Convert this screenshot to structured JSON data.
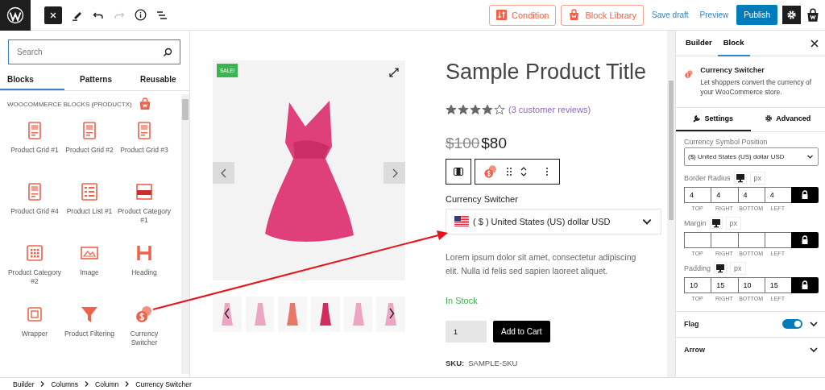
{
  "toolbar": {
    "buttons": [
      {
        "label": "Condition",
        "kind": "condition"
      },
      {
        "label": "Block Library",
        "kind": "library"
      }
    ],
    "links": [
      "Save draft",
      "Preview"
    ],
    "publish": "Publish"
  },
  "inserter": {
    "search": {
      "placeholder": "Search"
    },
    "tabs": [
      {
        "label": "Blocks",
        "selected": true
      },
      {
        "label": "Patterns",
        "selected": false
      },
      {
        "label": "Reusable",
        "selected": false
      }
    ],
    "category": "WOOCOMMERCE BLOCKS (PRODUCTX)",
    "blocks": [
      {
        "label": "Product Grid #1",
        "kind": "grid"
      },
      {
        "label": "Product Grid #2",
        "kind": "grid"
      },
      {
        "label": "Product Grid #3",
        "kind": "grid"
      },
      {
        "label": "Product Grid #4",
        "kind": "grid"
      },
      {
        "label": "Product List #1",
        "kind": "list"
      },
      {
        "label": "Product Category #1",
        "kind": "category"
      },
      {
        "label": "Product Category #2",
        "kind": "tiles"
      },
      {
        "label": "Image",
        "kind": "image"
      },
      {
        "label": "Heading",
        "kind": "heading"
      },
      {
        "label": "Wrapper",
        "kind": "wrapper"
      },
      {
        "label": "Product Filtering",
        "kind": "filter"
      },
      {
        "label": "Currency Switcher",
        "kind": "currency"
      }
    ]
  },
  "product": {
    "badge": "SALE!",
    "title": "Sample Product Title",
    "stars": 4,
    "reviews": "(3 customer reviews)",
    "old_price": "$100",
    "price": "$80",
    "switcher_label": "Currency Switcher",
    "switcher_value": "( $ ) United States (US) dollar USD",
    "description": "Lorem ipsum dolor sit amet, consectetur adipiscing elit. Nulla id felis sed sapien laoreet aliquet.",
    "stock": "In Stock",
    "quantity": "1",
    "add_to_cart": "Add to Cart",
    "sku_label": "SKU:",
    "sku": "SAMPLE-SKU"
  },
  "settings": {
    "tabs": [
      {
        "label": "Builder",
        "selected": false
      },
      {
        "label": "Block",
        "selected": true
      }
    ],
    "block_title": "Currency Switcher",
    "block_description": "Let shoppers convert the currency of your WooCommerce store.",
    "subtabs": [
      {
        "label": "Settings",
        "kind": "wrench",
        "selected": true
      },
      {
        "label": "Advanced",
        "kind": "gear",
        "selected": false
      }
    ],
    "symbol_position": {
      "label": "Currency Symbol Position",
      "value": "($) United States (US) dollar USD"
    },
    "spacing": [
      {
        "label": "Border Radius",
        "unit": "px",
        "values": [
          "4",
          "4",
          "4",
          "4"
        ],
        "sides": [
          "TOP",
          "RIGHT",
          "BOTTOM",
          "LEFT"
        ]
      },
      {
        "label": "Margin",
        "unit": "px",
        "sides": [
          "TOP",
          "RIGHT",
          "BOTTOM",
          "LEFT"
        ]
      },
      {
        "label": "Padding",
        "unit": "px",
        "values": [
          "10",
          "15",
          "10",
          "15"
        ],
        "sides": [
          "TOP",
          "RIGHT",
          "BOTTOM",
          "LEFT"
        ]
      }
    ],
    "sections": [
      {
        "label": "Flag",
        "kind": "toggle",
        "on": true
      },
      {
        "label": "Arrow",
        "kind": "plain"
      }
    ]
  },
  "breadcrumb": [
    "Builder",
    "Columns",
    "Column",
    "Currency Switcher"
  ]
}
